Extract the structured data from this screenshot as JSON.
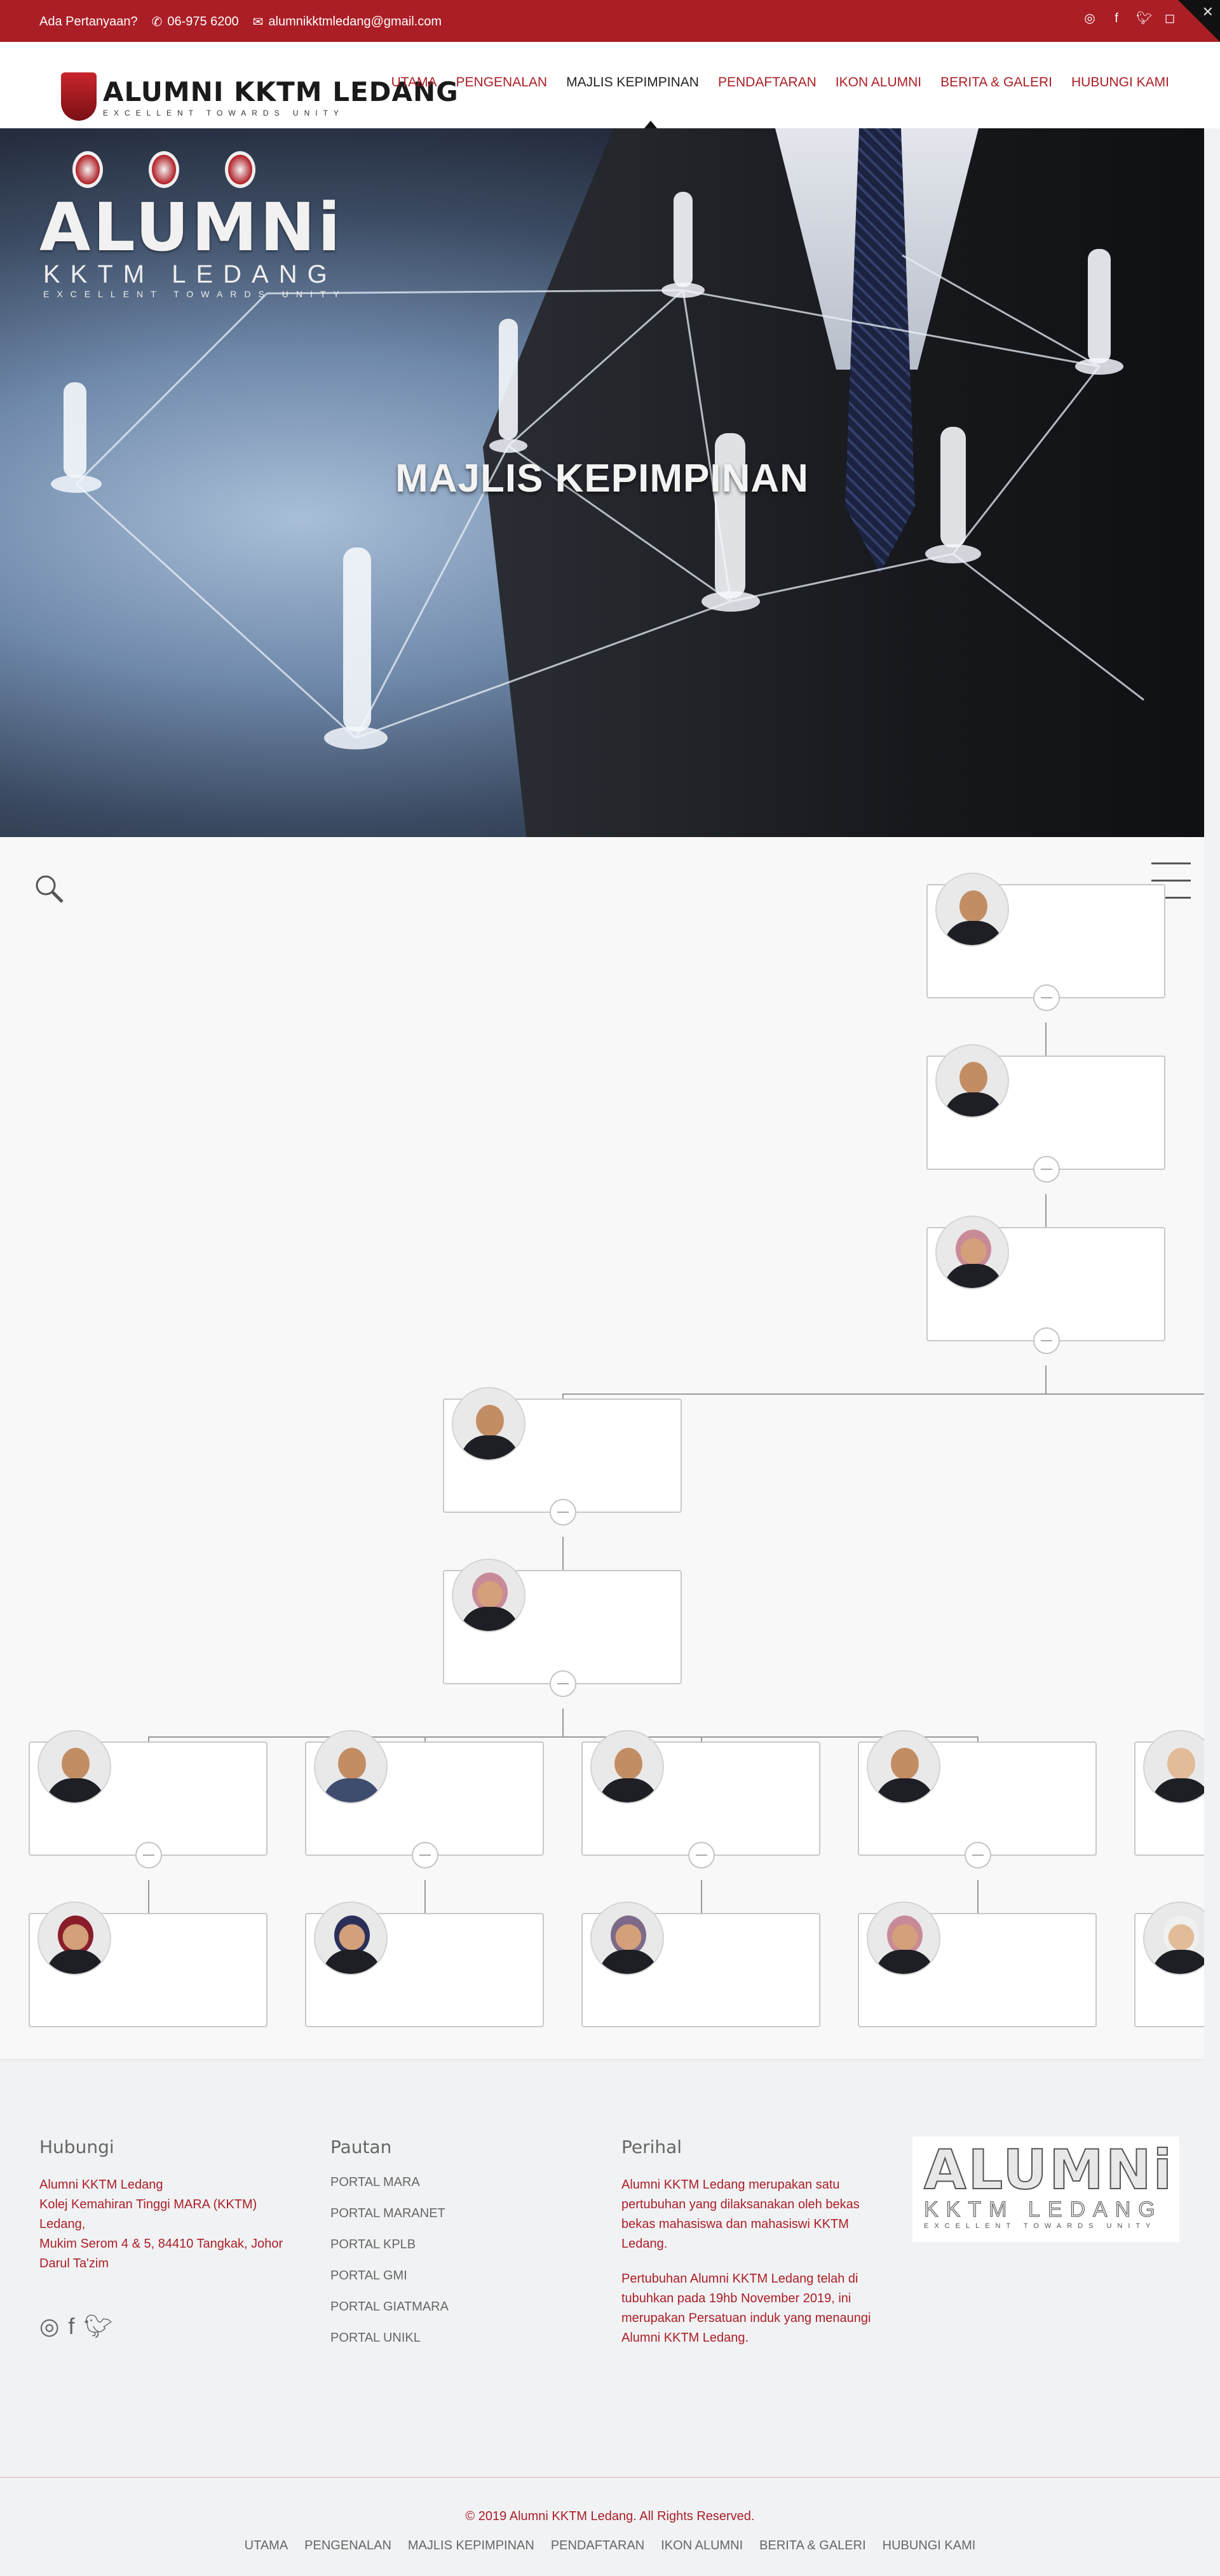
{
  "topbar": {
    "question": "Ada Pertanyaan?",
    "phone": "06-975 6200",
    "email": "alumnikktmledang@gmail.com",
    "social_icons": [
      "whatsapp-icon",
      "facebook-icon",
      "twitter-icon",
      "instagram-icon"
    ],
    "background": "#ab1e26"
  },
  "header": {
    "logo_text": "ALUMNI KKTM LEDANG",
    "logo_tagline": "EXCELLENT TOWARDS UNITY",
    "nav": [
      "UTAMA",
      "PENGENALAN",
      "MAJLIS KEPIMPINAN",
      "PENDAFTARAN",
      "IKON ALUMNI",
      "BERITA & GALERI",
      "HUBUNGI KAMI"
    ],
    "active_nav": "MAJLIS KEPIMPINAN"
  },
  "hero": {
    "logo_big": "ALUMNi",
    "logo_mid": "KKTM LEDANG",
    "logo_small": "EXCELLENT TOWARDS UNITY",
    "caption": "MAJLIS KEPIMPINAN"
  },
  "orgchart": {
    "icons": [
      "search-icon",
      "hamburger-menu-icon"
    ]
  },
  "footer": {
    "hubungi": {
      "title": "Hubungi",
      "line1": "Alumni KKTM Ledang",
      "line2": "Kolej Kemahiran Tinggi MARA (KKTM) Ledang,",
      "line3": "Mukim Serom 4 & 5, 84410 Tangkak, Johor Darul Ta'zim"
    },
    "pautan": {
      "title": "Pautan",
      "links": [
        "PORTAL MARA",
        "PORTAL MARANET",
        "PORTAL KPLB",
        "PORTAL GMI",
        "PORTAL GIATMARA",
        "PORTAL UNIKL"
      ]
    },
    "perihal": {
      "title": "Perihal",
      "p1": "Alumni KKTM Ledang merupakan satu pertubuhan yang dilaksanakan oleh bekas bekas mahasiswa dan mahasiswi KKTM Ledang.",
      "p2": "Pertubuhan Alumni KKTM Ledang telah di tubuhkan pada 19hb November 2019, ini merupakan Persatuan induk yang menaungi Alumni KKTM Ledang."
    },
    "logo_big": "ALUMNi",
    "logo_mid": "KKTM LEDANG",
    "logo_small": "EXCELLENT TOWARDS UNITY",
    "social_icons": [
      "instagram-icon",
      "facebook-icon",
      "twitter-icon"
    ],
    "copyright": "© 2019 Alumni KKTM Ledang. All Rights Reserved.",
    "bottom_nav": [
      "UTAMA",
      "PENGENALAN",
      "MAJLIS KEPIMPINAN",
      "PENDAFTARAN",
      "IKON ALUMNI",
      "BERITA & GALERI",
      "HUBUNGI KAMI"
    ]
  }
}
